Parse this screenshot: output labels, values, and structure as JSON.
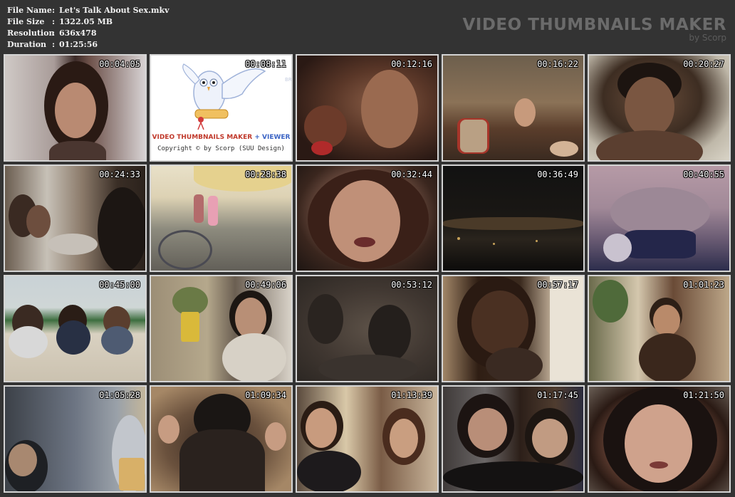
{
  "info": {
    "rows": [
      {
        "label": "File Name",
        "sep": ":",
        "value": "Let's Talk About Sex.mkv"
      },
      {
        "label": "File Size",
        "sep": ":",
        "value": "1322.05 MB"
      },
      {
        "label": "Resolution",
        "sep": ":",
        "value": "636x478"
      },
      {
        "label": "Duration",
        "sep": ":",
        "value": "01:25:56"
      }
    ]
  },
  "brand": {
    "title": "VIDEO THUMBNAILS MAKER",
    "byline": "by Scorp"
  },
  "logo_thumb": {
    "title_red": "VIDEO THUMBNAILS MAKER",
    "title_plus": " + ",
    "title_blue": "VIEWER",
    "copyright": "Copyright © by Scorp (SUU Design)"
  },
  "thumbnails": [
    {
      "time": "00:04:05"
    },
    {
      "time": "00:08:11"
    },
    {
      "time": "00:12:16"
    },
    {
      "time": "00:16:22"
    },
    {
      "time": "00:20:27"
    },
    {
      "time": "00:24:33"
    },
    {
      "time": "00:28:38"
    },
    {
      "time": "00:32:44"
    },
    {
      "time": "00:36:49"
    },
    {
      "time": "00:40:55"
    },
    {
      "time": "00:45:00"
    },
    {
      "time": "00:49:06"
    },
    {
      "time": "00:53:12"
    },
    {
      "time": "00:57:17"
    },
    {
      "time": "01:01:23"
    },
    {
      "time": "01:05:28"
    },
    {
      "time": "01:09:34"
    },
    {
      "time": "01:13:39"
    },
    {
      "time": "01:17:45"
    },
    {
      "time": "01:21:50"
    }
  ],
  "colors": {
    "background": "#333333",
    "thumb_border": "#d4d4d4",
    "brand_text": "#6b6b6b"
  }
}
